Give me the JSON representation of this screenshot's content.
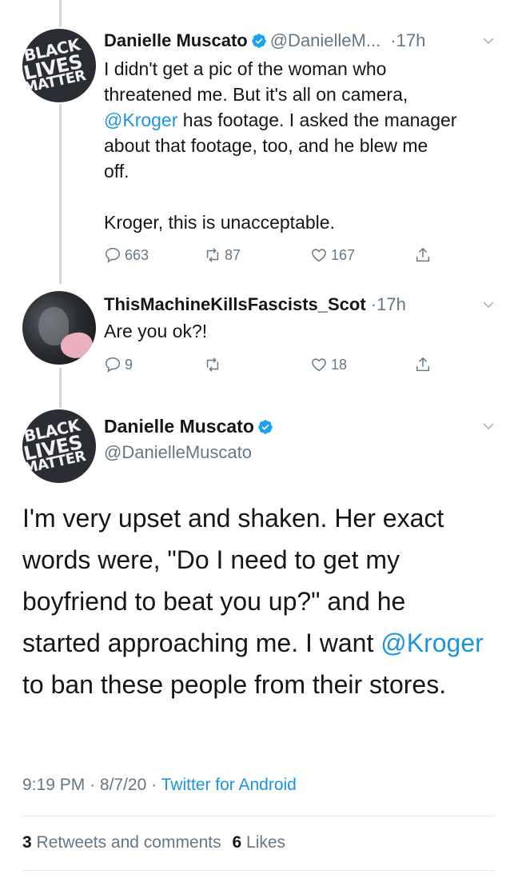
{
  "tweets": [
    {
      "name": "Danielle Muscato",
      "handle": "@DanielleM...",
      "dot": "·",
      "time": "17h",
      "text_lines": [
        "I didn't get a pic of the woman who",
        "threatened me. But it's all on camera,"
      ],
      "mention": "@Kroger",
      "text_after_mention": " has footage. I asked the manager\nabout that footage, too, and he blew me\noff.\n\nKroger, this is unacceptable.",
      "replies": "663",
      "retweets": "87",
      "likes": "167",
      "avatar_text": [
        "BLACK",
        "LIVES",
        "MATTER"
      ]
    },
    {
      "name": "ThisMachineKillsFascists_Scot",
      "dot": "·",
      "time": "17h",
      "text": "Are you ok?!",
      "replies": "9",
      "retweets": "",
      "likes": "18"
    }
  ],
  "main_tweet": {
    "name": "Danielle Muscato",
    "handle": "@DanielleMuscato",
    "avatar_text": [
      "BLACK",
      "LIVES",
      "MATTER"
    ],
    "text_before": "I'm very upset and shaken. Her exact words were, \"Do I need to get my boyfriend to beat you up?\" and he started approaching me. I want ",
    "mention": "@Kroger",
    "text_after": " to ban these people from their stores.",
    "time": "9:19 PM",
    "date": "8/7/20",
    "sep": "·",
    "source": "Twitter for Android",
    "retweets_count": "3",
    "retweets_label": "Retweets and comments",
    "likes_count": "6",
    "likes_label": "Likes"
  },
  "colors": {
    "link": "#1b95e0",
    "secondary": "#657786",
    "verified": "#1da1f2"
  }
}
